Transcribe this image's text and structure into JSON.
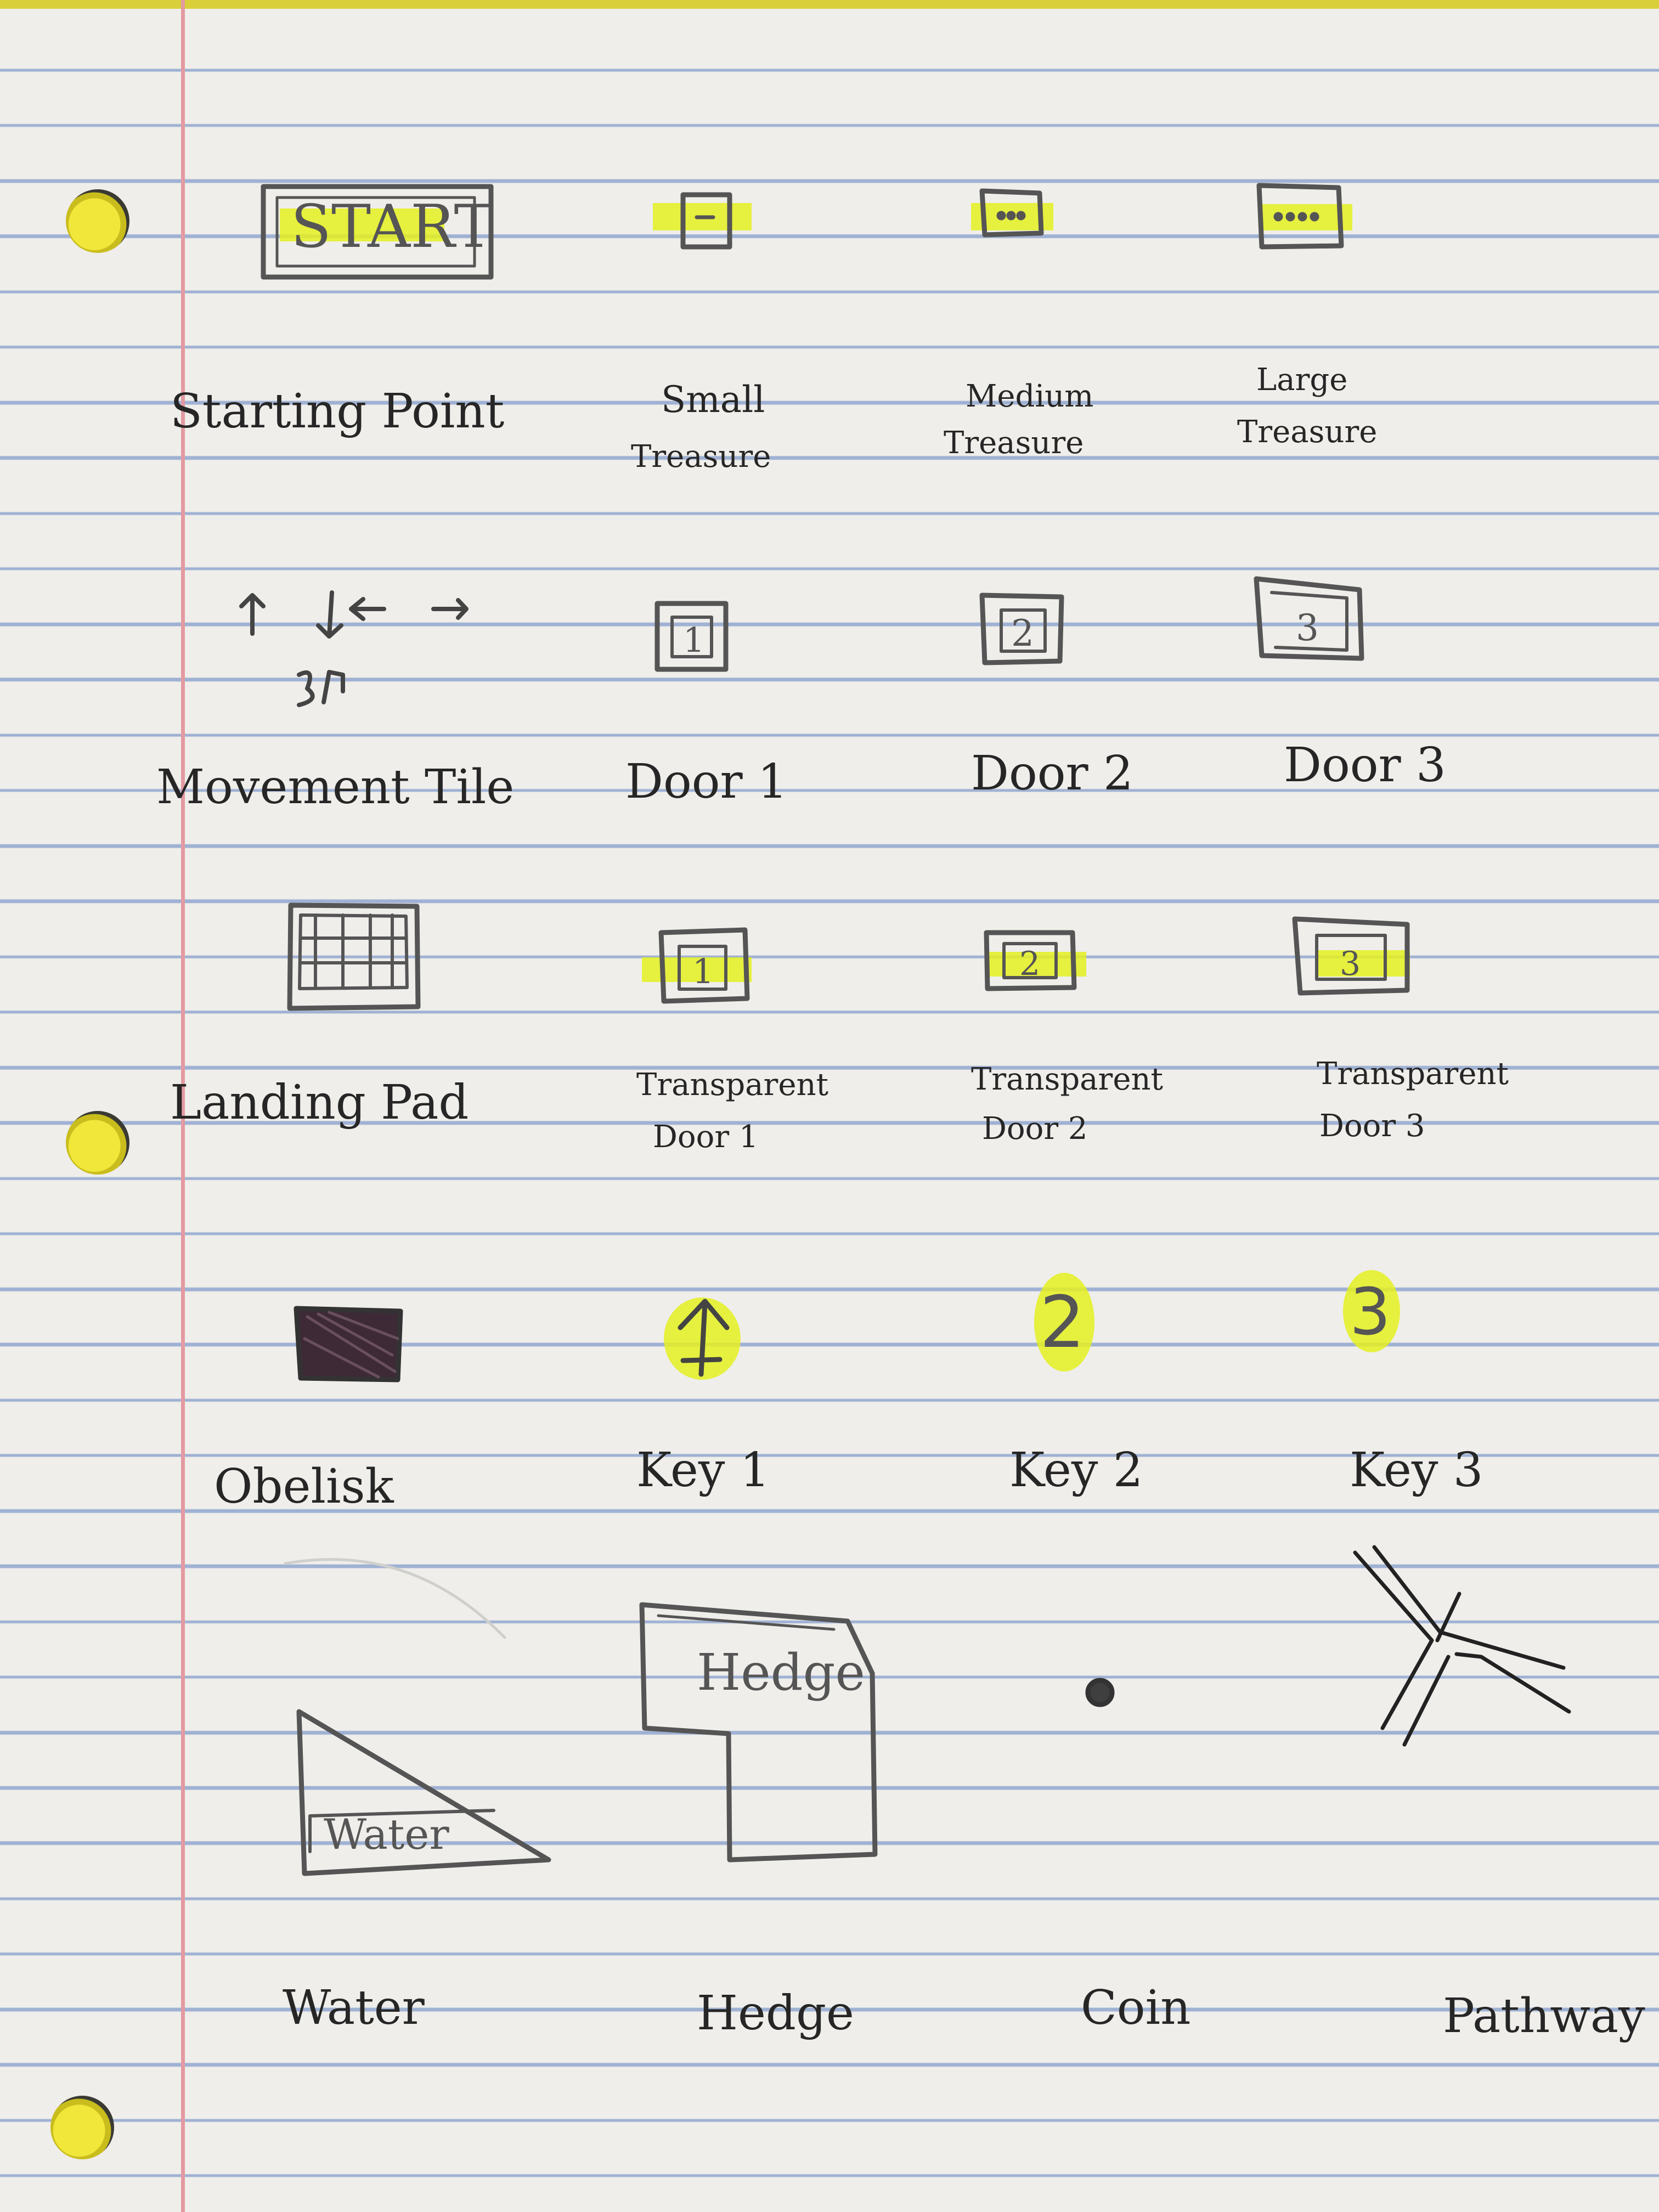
{
  "sheet": {
    "paper_color": "#efeeea",
    "rule_color": "#9fb1d3",
    "margin_color": "#e39aa2",
    "highlighter_color": "#e4f020",
    "pencil_color": "#555555",
    "ink_color": "#262626"
  },
  "legend": [
    {
      "id": "start",
      "drawing_text": "START",
      "label": "Starting Point"
    },
    {
      "id": "small-treasure",
      "label_line1": "Small",
      "label_line2": "Treasure"
    },
    {
      "id": "medium-treasure",
      "label_line1": "Medium",
      "label_line2": "Treasure"
    },
    {
      "id": "large-treasure",
      "label_line1": "Large",
      "label_line2": "Treasure"
    },
    {
      "id": "movement-tile",
      "label": "Movement Tile"
    },
    {
      "id": "door-1",
      "drawing_text": "1",
      "label": "Door 1"
    },
    {
      "id": "door-2",
      "drawing_text": "2",
      "label": "Door 2"
    },
    {
      "id": "door-3",
      "drawing_text": "3",
      "label": "Door 3"
    },
    {
      "id": "landing-pad",
      "label": "Landing Pad"
    },
    {
      "id": "transparent-door-1",
      "drawing_text": "1",
      "label_line1": "Transparent",
      "label_line2": "Door 1"
    },
    {
      "id": "transparent-door-2",
      "drawing_text": "2",
      "label_line1": "Transparent",
      "label_line2": "Door 2"
    },
    {
      "id": "transparent-door-3",
      "drawing_text": "3",
      "label_line1": "Transparent",
      "label_line2": "Door 3"
    },
    {
      "id": "obelisk",
      "label": "Obelisk"
    },
    {
      "id": "key-1",
      "label": "Key 1"
    },
    {
      "id": "key-2",
      "drawing_text": "2",
      "label": "Key 2"
    },
    {
      "id": "key-3",
      "drawing_text": "3",
      "label": "Key 3"
    },
    {
      "id": "water",
      "drawing_text": "Water",
      "label": "Water"
    },
    {
      "id": "hedge",
      "drawing_text": "Hedge",
      "label": "Hedge"
    },
    {
      "id": "coin",
      "label": "Coin"
    },
    {
      "id": "pathway",
      "label": "Pathway"
    }
  ]
}
